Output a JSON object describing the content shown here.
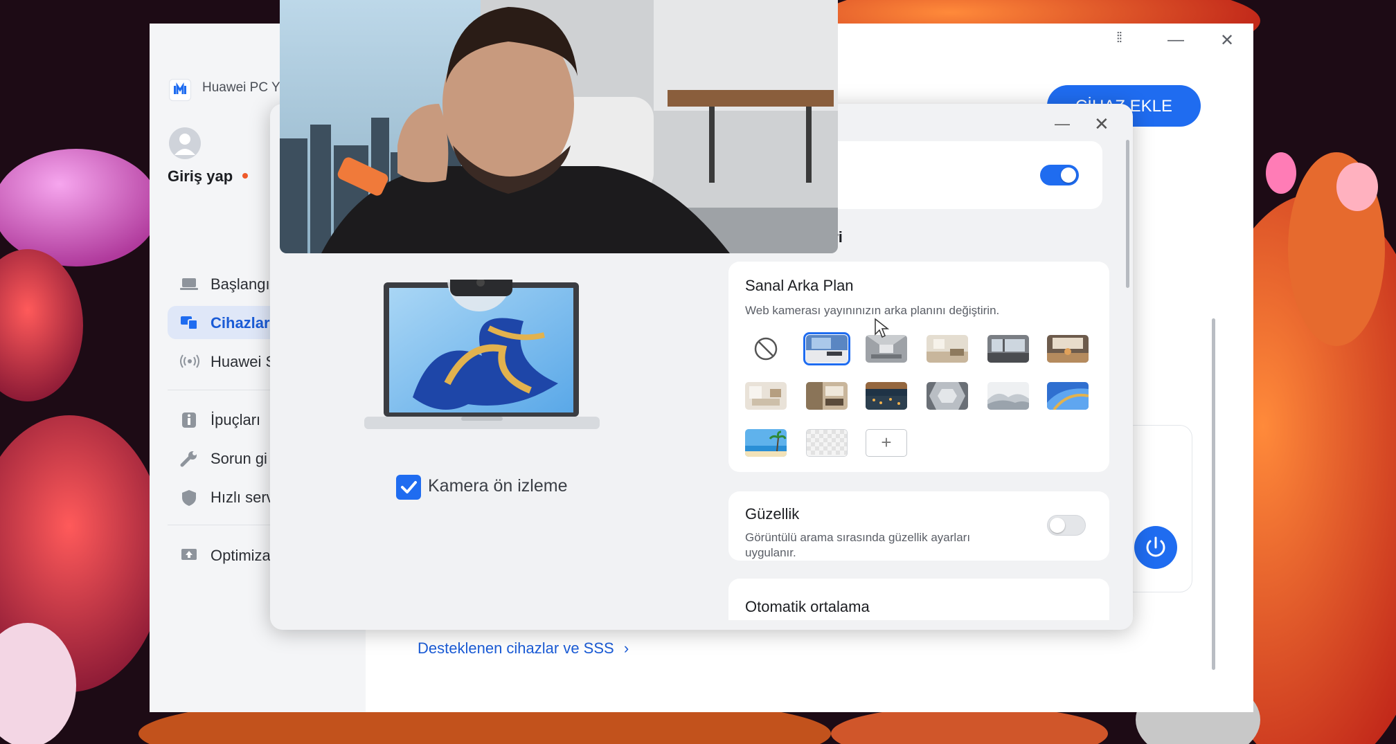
{
  "app": {
    "title": "Huawei PC Y",
    "login_label": "Giriş yap"
  },
  "window_controls": {
    "grid": "⁞⁞",
    "minimize": "—",
    "close": "✕"
  },
  "sidebar": {
    "items": [
      {
        "label": "Başlangı",
        "icon": "laptop-icon",
        "active": false
      },
      {
        "label": "Cihazlar",
        "icon": "devices-icon",
        "active": true
      },
      {
        "label": "Huawei S",
        "icon": "wireless-icon",
        "active": false
      },
      {
        "label": "İpuçları",
        "icon": "info-icon",
        "active": false
      },
      {
        "label": "Sorun gi",
        "icon": "wrench-icon",
        "active": false
      },
      {
        "label": "Hızlı serv",
        "icon": "shield-icon",
        "active": false
      },
      {
        "label": "Optimiza",
        "icon": "optimize-icon",
        "active": false
      }
    ]
  },
  "main": {
    "add_device_label": "CİHAZ EKLE",
    "support_link": "Desteklenen cihazlar ve SSS",
    "support_chevron": "›"
  },
  "dialog": {
    "minimize": "—",
    "close": "✕",
    "section_heading_partial": "eri",
    "camera_preview_label": "Kamera ön izleme",
    "camera_preview_checked": true,
    "camera_toggle_on": true,
    "virtual_bg": {
      "title": "Sanal Arka Plan",
      "description": "Web kamerası yayınınızın arka planını değiştirin.",
      "selected_index": 1,
      "add_label": "+"
    },
    "beauty": {
      "title": "Güzellik",
      "description_line1": "Görüntülü arama sırasında güzellik ayarları",
      "description_line2": "uygulanır.",
      "enabled": false
    },
    "auto_center": {
      "title": "Otomatik ortalama"
    }
  },
  "colors": {
    "accent": "#1f6cf0",
    "link": "#1a5bd6",
    "notification_dot": "#ee5a2a"
  }
}
